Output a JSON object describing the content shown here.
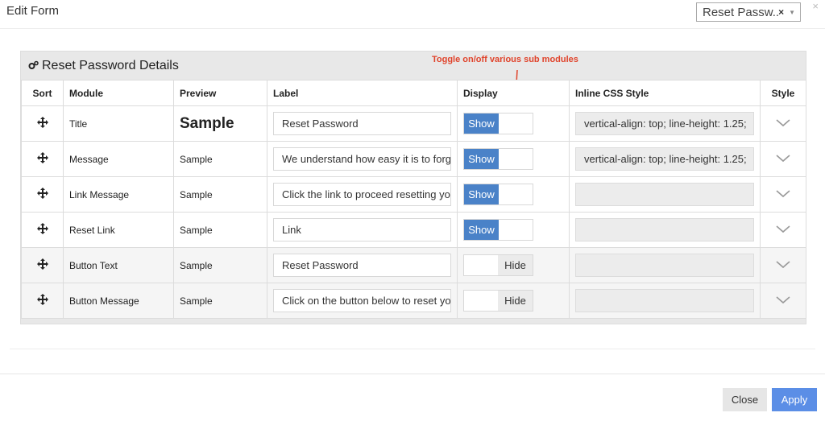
{
  "modal": {
    "title": "Edit Form",
    "close_icon": "×",
    "form_select": {
      "value": "Reset Passw...",
      "clear": "×",
      "caret": "▼"
    }
  },
  "panel": {
    "title": "Reset Password Details",
    "icon": "gears-icon"
  },
  "annotation": {
    "text": "Toggle on/off various sub modules",
    "color": "#e0432b"
  },
  "table": {
    "headers": {
      "sort": "Sort",
      "module": "Module",
      "preview": "Preview",
      "label": "Label",
      "display": "Display",
      "css": "Inline CSS Style",
      "style": "Style"
    },
    "rows": [
      {
        "module": "Title",
        "preview": "Sample",
        "label": "Reset Password",
        "display": "Show",
        "css": "vertical-align: top; line-height: 1.25;"
      },
      {
        "module": "Message",
        "preview": "Sample",
        "label": "We understand how easy it is to forget",
        "display": "Show",
        "css": "vertical-align: top; line-height: 1.25;"
      },
      {
        "module": "Link Message",
        "preview": "Sample",
        "label": "Click the link to proceed resetting your",
        "display": "Show",
        "css": ""
      },
      {
        "module": "Reset Link",
        "preview": "Sample",
        "label": "Link",
        "display": "Show",
        "css": ""
      },
      {
        "module": "Button Text",
        "preview": "Sample",
        "label": "Reset Password",
        "display": "Hide",
        "css": ""
      },
      {
        "module": "Button Message",
        "preview": "Sample",
        "label": "Click on the button below to reset your",
        "display": "Hide",
        "css": ""
      }
    ]
  },
  "footer": {
    "close_label": "Close",
    "apply_label": "Apply"
  },
  "colors": {
    "accent": "#5b8ee6",
    "toggle_on": "#4a82c8"
  }
}
